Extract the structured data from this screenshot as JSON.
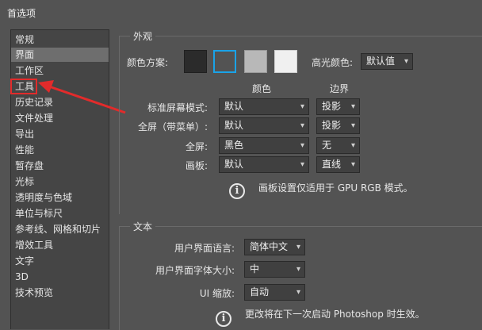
{
  "window": {
    "title": "首选项"
  },
  "sidebar": {
    "items": [
      "常规",
      "界面",
      "工作区",
      "工具",
      "历史记录",
      "文件处理",
      "导出",
      "性能",
      "暂存盘",
      "光标",
      "透明度与色域",
      "单位与标尺",
      "参考线、网格和切片",
      "增效工具",
      "文字",
      "3D",
      "技术预览"
    ],
    "selected_index": 1,
    "highlighted_index": 3
  },
  "appearance": {
    "title": "外观",
    "color_scheme_label": "颜色方案:",
    "swatches": [
      "#2b2b2b",
      "#535353",
      "#b8b8b8",
      "#f0f0f0"
    ],
    "selected_swatch": 1,
    "highlight_color_label": "高光颜色:",
    "highlight_color_value": "默认值",
    "col_color": "颜色",
    "col_border": "边界",
    "rows": [
      {
        "label": "标准屏幕模式:",
        "color": "默认",
        "border": "投影"
      },
      {
        "label": "全屏（带菜单）:",
        "color": "默认",
        "border": "投影"
      },
      {
        "label": "全屏:",
        "color": "黑色",
        "border": "无"
      },
      {
        "label": "画板:",
        "color": "默认",
        "border": "直线"
      }
    ],
    "note": "画板设置仅适用于 GPU RGB 模式。"
  },
  "text": {
    "title": "文本",
    "ui_language_label": "用户界面语言:",
    "ui_language_value": "简体中文",
    "ui_font_size_label": "用户界面字体大小:",
    "ui_font_size_value": "中",
    "ui_scale_label": "UI 缩放:",
    "ui_scale_value": "自动",
    "note": "更改将在下一次启动 Photoshop 时生效。"
  },
  "colors": {
    "accent": "#1aa3e8",
    "annotation": "#e22b2b"
  }
}
